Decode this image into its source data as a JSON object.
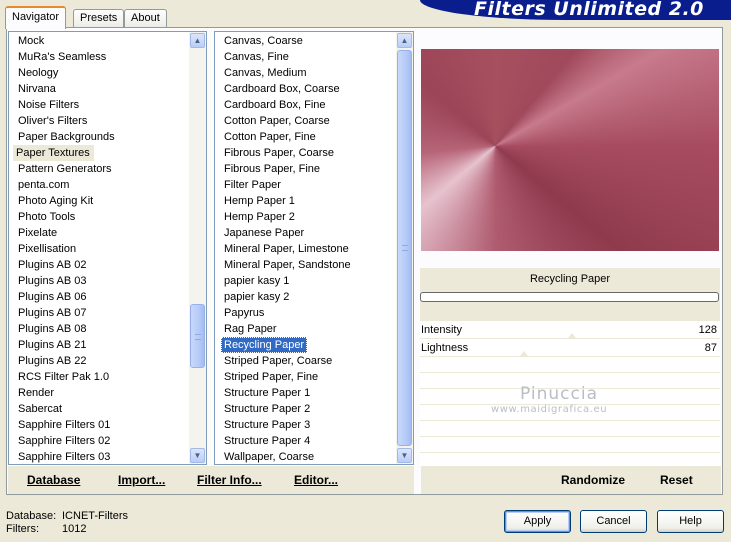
{
  "tabs": [
    "Navigator",
    "Presets",
    "About"
  ],
  "banner_title": "Filters Unlimited 2.0",
  "categories": {
    "items": [
      "Mock",
      "MuRa's Seamless",
      "Neology",
      "Nirvana",
      "Noise Filters",
      "Oliver's Filters",
      "Paper Backgrounds",
      "Paper Textures",
      "Pattern Generators",
      "penta.com",
      "Photo Aging Kit",
      "Photo Tools",
      "Pixelate",
      "Pixellisation",
      "Plugins AB 02",
      "Plugins AB 03",
      "Plugins AB 06",
      "Plugins AB 07",
      "Plugins AB 08",
      "Plugins AB 21",
      "Plugins AB 22",
      "RCS Filter Pak 1.0",
      "Render",
      "Sabercat",
      "Sapphire Filters 01",
      "Sapphire Filters 02",
      "Sapphire Filters 03"
    ],
    "highlighted": "Paper Textures"
  },
  "filters": {
    "items": [
      "Canvas, Coarse",
      "Canvas, Fine",
      "Canvas, Medium",
      "Cardboard Box, Coarse",
      "Cardboard Box, Fine",
      "Cotton Paper, Coarse",
      "Cotton Paper, Fine",
      "Fibrous Paper, Coarse",
      "Fibrous Paper, Fine",
      "Filter Paper",
      "Hemp Paper 1",
      "Hemp Paper 2",
      "Japanese Paper",
      "Mineral Paper, Limestone",
      "Mineral Paper, Sandstone",
      "papier kasy 1",
      "papier kasy 2",
      "Papyrus",
      "Rag Paper",
      "Recycling Paper",
      "Striped Paper, Coarse",
      "Striped Paper, Fine",
      "Structure Paper 1",
      "Structure Paper 2",
      "Structure Paper 3",
      "Structure Paper 4",
      "Wallpaper, Coarse"
    ],
    "selected": "Recycling Paper"
  },
  "preview": {
    "filter_name": "Recycling Paper",
    "progress": 0
  },
  "sliders": [
    {
      "label": "Intensity",
      "value": "128"
    },
    {
      "label": "Lightness",
      "value": "87"
    }
  ],
  "watermark": {
    "name": "Pinuccia",
    "url": "www.maidigrafica.eu"
  },
  "bottom_buttons": {
    "database": "Database",
    "import": "Import...",
    "filter_info": "Filter Info...",
    "editor": "Editor...",
    "randomize": "Randomize",
    "reset": "Reset"
  },
  "footer": {
    "database_label": "Database:",
    "database_value": "ICNET-Filters",
    "filters_label": "Filters:",
    "filters_value": "1012"
  },
  "dialog_buttons": {
    "apply": "Apply",
    "cancel": "Cancel",
    "help": "Help"
  },
  "colors": {
    "selection": "#316ac5",
    "banner": "#0a1d8c",
    "preview_base": "#a0495c"
  }
}
